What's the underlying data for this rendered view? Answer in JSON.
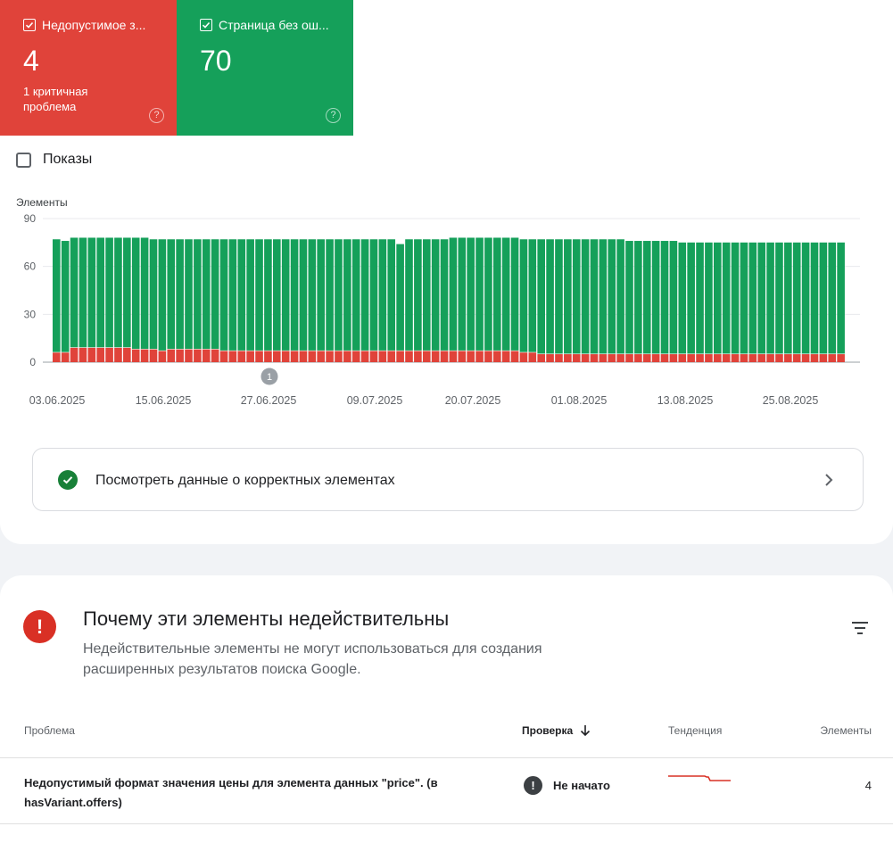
{
  "tiles": {
    "invalid": {
      "label": "Недопустимое з...",
      "count": "4",
      "sub": "1 критичная проблема",
      "color": "#e0433a"
    },
    "valid": {
      "label": "Страница без ош...",
      "count": "70",
      "color": "#15a05a"
    }
  },
  "impressions": {
    "label": "Показы",
    "checked": false
  },
  "chart_data": {
    "type": "bar",
    "stacked": true,
    "ylabel": "Элементы",
    "ylim": [
      0,
      90
    ],
    "yticks": [
      0,
      30,
      60,
      90
    ],
    "xtick_labels": [
      "03.06.2025",
      "15.06.2025",
      "27.06.2025",
      "09.07.2025",
      "20.07.2025",
      "01.08.2025",
      "13.08.2025",
      "25.08.2025"
    ],
    "annotation": "1",
    "series": [
      {
        "color": "#e0433a",
        "values": [
          6,
          6,
          9,
          9,
          9,
          9,
          9,
          9,
          9,
          8,
          8,
          8,
          7,
          8,
          8,
          8,
          8,
          8,
          8,
          7,
          7,
          7,
          7,
          7,
          7,
          7,
          7,
          7,
          7,
          7,
          7,
          7,
          7,
          7,
          7,
          7,
          7,
          7,
          7,
          7,
          7,
          7,
          7,
          7,
          7,
          7,
          7,
          7,
          7,
          7,
          7,
          7,
          7,
          6,
          6,
          5,
          5,
          5,
          5,
          5,
          5,
          5,
          5,
          5,
          5,
          5,
          5,
          5,
          5,
          5,
          5,
          5,
          5,
          5,
          5,
          5,
          5,
          5,
          5,
          5,
          5,
          5,
          5,
          5,
          5,
          5,
          5,
          5,
          5,
          5
        ]
      },
      {
        "color": "#15a05a",
        "values": [
          71,
          70,
          69,
          69,
          69,
          69,
          69,
          69,
          69,
          70,
          70,
          69,
          70,
          69,
          69,
          69,
          69,
          69,
          69,
          70,
          70,
          70,
          70,
          70,
          70,
          70,
          70,
          70,
          70,
          70,
          70,
          70,
          70,
          70,
          70,
          70,
          70,
          70,
          70,
          67,
          70,
          70,
          70,
          70,
          70,
          71,
          71,
          71,
          71,
          71,
          71,
          71,
          71,
          71,
          71,
          72,
          72,
          72,
          72,
          72,
          72,
          72,
          72,
          72,
          72,
          71,
          71,
          71,
          71,
          71,
          71,
          70,
          70,
          70,
          70,
          70,
          70,
          70,
          70,
          70,
          70,
          70,
          70,
          70,
          70,
          70,
          70,
          70,
          70,
          70
        ]
      }
    ]
  },
  "valid_link": {
    "label": "Посмотреть данные о корректных элементах"
  },
  "section": {
    "title": "Почему эти элементы недействительны",
    "description": "Недействительные элементы не могут использоваться для создания расширенных результатов поиска Google."
  },
  "table": {
    "headers": {
      "issue": "Проблема",
      "validation": "Проверка",
      "trend": "Тенденция",
      "items": "Элементы"
    },
    "rows": [
      {
        "issue": "Недопустимый формат значения цены для элемента данных \"price\". (в hasVariant.offers)",
        "status": "Не начато",
        "count": "4"
      }
    ]
  }
}
